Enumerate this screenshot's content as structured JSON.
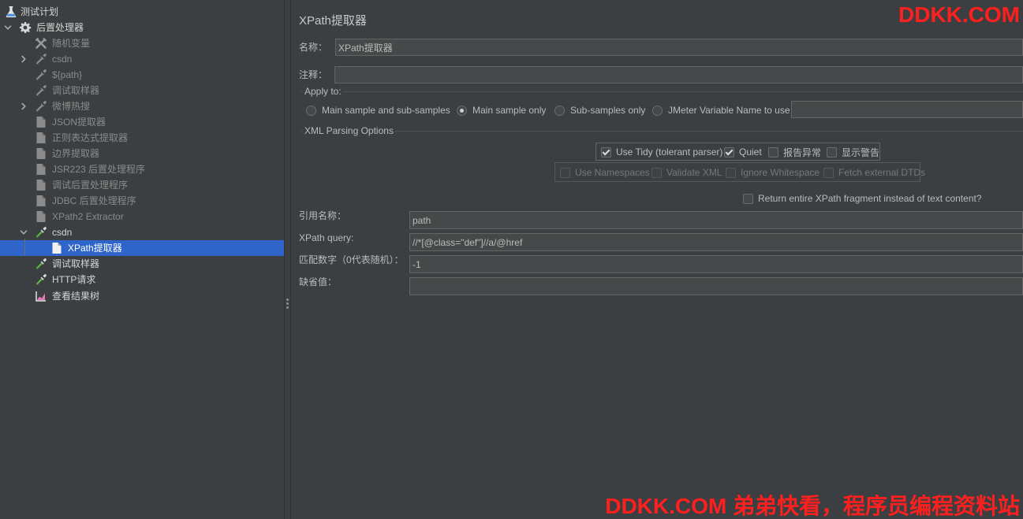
{
  "theme": {
    "background": "#3c3f41",
    "text": "#bbbbbb",
    "disabled_text": "#8a8a8a",
    "selection": "#2f65ca",
    "input_background": "#45494a",
    "input_border": "#646464",
    "watermark": "#ff1f1f"
  },
  "tree": {
    "items": [
      {
        "label": "测试计划",
        "icon": "flask-icon",
        "disabled": false
      },
      {
        "label": "后置处理器",
        "icon": "gear-icon",
        "disabled": false,
        "expanded": true
      },
      {
        "label": "随机变量",
        "icon": "config-tools-icon",
        "disabled": true
      },
      {
        "label": "csdn",
        "icon": "pipette-icon",
        "disabled": true,
        "expanded": false
      },
      {
        "label": "${path}",
        "icon": "pipette-icon",
        "disabled": true
      },
      {
        "label": "调试取样器",
        "icon": "pipette-icon",
        "disabled": true
      },
      {
        "label": "微博热搜",
        "icon": "pipette-icon",
        "disabled": true,
        "expanded": false
      },
      {
        "label": "JSON提取器",
        "icon": "document-icon",
        "disabled": true
      },
      {
        "label": "正则表达式提取器",
        "icon": "document-icon",
        "disabled": true
      },
      {
        "label": "边界提取器",
        "icon": "document-icon",
        "disabled": true
      },
      {
        "label": "JSR223 后置处理程序",
        "icon": "document-icon",
        "disabled": true
      },
      {
        "label": "调试后置处理程序",
        "icon": "document-icon",
        "disabled": true
      },
      {
        "label": "JDBC 后置处理程序",
        "icon": "document-icon",
        "disabled": true
      },
      {
        "label": "XPath2 Extractor",
        "icon": "document-icon",
        "disabled": true
      },
      {
        "label": "csdn",
        "icon": "pipette-icon",
        "disabled": false,
        "expanded": true
      },
      {
        "label": "XPath提取器",
        "icon": "document-icon",
        "disabled": false,
        "selected": true
      },
      {
        "label": "调试取样器",
        "icon": "pipette-icon",
        "disabled": false
      },
      {
        "label": "HTTP请求",
        "icon": "pipette-icon",
        "disabled": false
      },
      {
        "label": "查看结果树",
        "icon": "chart-icon",
        "disabled": false
      }
    ]
  },
  "panel": {
    "title": "XPath提取器",
    "name": {
      "label": "名称：",
      "value": "XPath提取器"
    },
    "comment": {
      "label": "注释：",
      "value": ""
    },
    "apply_to": {
      "title": "Apply to:",
      "options": [
        {
          "label": "Main sample and sub-samples",
          "selected": false
        },
        {
          "label": "Main sample only",
          "selected": true
        },
        {
          "label": "Sub-samples only",
          "selected": false
        },
        {
          "label": "JMeter Variable Name to use",
          "selected": false
        }
      ],
      "variable_name": ""
    },
    "xml_parsing": {
      "title": "XML Parsing Options",
      "tidy_options": [
        {
          "label": "Use Tidy (tolerant parser)",
          "checked": true
        },
        {
          "label": "Quiet",
          "checked": true
        },
        {
          "label": "报告异常",
          "checked": false
        },
        {
          "label": "显示警告",
          "checked": false
        }
      ],
      "parser_options": [
        {
          "label": "Use Namespaces",
          "checked": false,
          "disabled": true
        },
        {
          "label": "Validate XML",
          "checked": false,
          "disabled": true
        },
        {
          "label": "Ignore Whitespace",
          "checked": false,
          "disabled": true
        },
        {
          "label": "Fetch external DTDs",
          "checked": false,
          "disabled": true
        }
      ],
      "return_fragment": {
        "label": "Return entire XPath fragment instead of text content?",
        "checked": false
      }
    },
    "fields": [
      {
        "label": "引用名称：",
        "value": "path"
      },
      {
        "label": "XPath query:",
        "value": "//*[@class=\"def\"]//a/@href"
      },
      {
        "label": "匹配数字（0代表随机）：",
        "value": "-1"
      },
      {
        "label": "缺省值：",
        "value": ""
      }
    ]
  },
  "watermarks": {
    "top": "DDKK.COM",
    "bottom": "DDKK.COM 弟弟快看，程序员编程资料站"
  }
}
